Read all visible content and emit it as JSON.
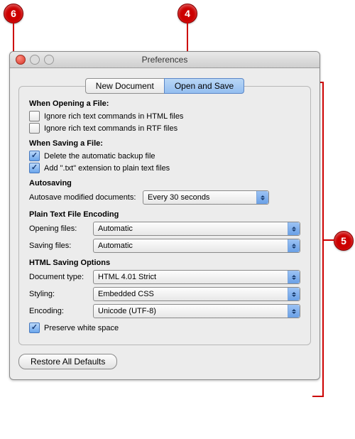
{
  "callouts": {
    "c4": "4",
    "c5": "5",
    "c6": "6"
  },
  "window": {
    "title": "Preferences",
    "tabs": {
      "new_doc": "New Document",
      "open_save": "Open and Save"
    },
    "opening": {
      "heading": "When Opening a File:",
      "ignore_html": "Ignore rich text commands in HTML files",
      "ignore_rtf": "Ignore rich text commands in RTF files"
    },
    "saving": {
      "heading": "When Saving a File:",
      "delete_backup": "Delete the automatic backup file",
      "add_txt": "Add \".txt\" extension to plain text files"
    },
    "autosave": {
      "heading": "Autosaving",
      "label": "Autosave modified documents:",
      "value": "Every 30 seconds"
    },
    "encoding": {
      "heading": "Plain Text File Encoding",
      "opening_label": "Opening files:",
      "opening_value": "Automatic",
      "saving_label": "Saving files:",
      "saving_value": "Automatic"
    },
    "html": {
      "heading": "HTML Saving Options",
      "doctype_label": "Document type:",
      "doctype_value": "HTML 4.01 Strict",
      "styling_label": "Styling:",
      "styling_value": "Embedded CSS",
      "encoding_label": "Encoding:",
      "encoding_value": "Unicode (UTF-8)",
      "preserve": "Preserve white space"
    },
    "restore": "Restore All Defaults"
  }
}
